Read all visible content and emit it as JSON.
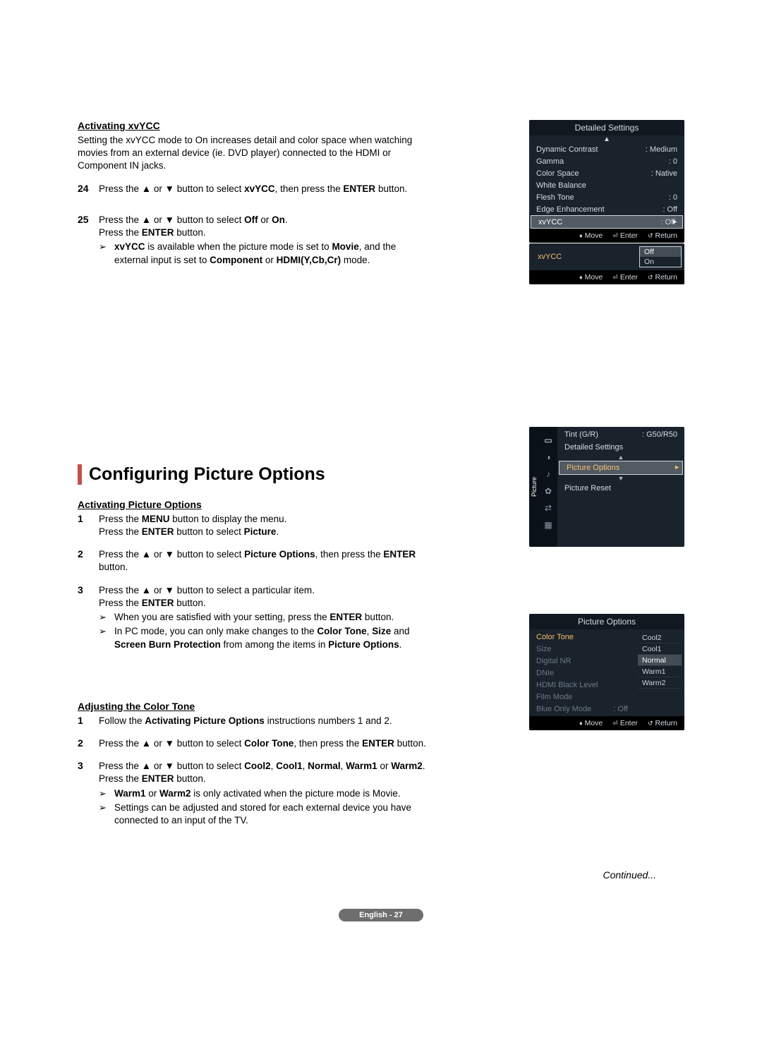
{
  "sect1": {
    "heading": "Activating xvYCC",
    "intro": "Setting the xvYCC mode to On increases detail and color space when watching movies from an external device (ie. DVD player) connected to the HDMI or Component IN jacks.",
    "step24_num": "24",
    "step24_a": "Press the ▲ or ▼ button to select ",
    "step24_b": "xvYCC",
    "step24_c": ", then press the ",
    "step24_d": "ENTER",
    "step24_e": " button.",
    "step25_num": "25",
    "step25_a": "Press the ▲ or ▼ button to select ",
    "step25_b": "Off",
    "step25_c": " or ",
    "step25_d": "On",
    "step25_e": ".",
    "step25_f": "Press the ",
    "step25_g": "ENTER",
    "step25_h": " button.",
    "note_a": "xvYCC",
    "note_b": " is available when the picture mode is set to ",
    "note_c": "Movie",
    "note_d": ", and the external input is set to ",
    "note_e": "Component",
    "note_f": " or ",
    "note_g": "HDMI(Y,Cb,Cr)",
    "note_h": " mode."
  },
  "osd1": {
    "title": "Detailed Settings",
    "rows": [
      {
        "label": "Dynamic Contrast",
        "val": ": Medium"
      },
      {
        "label": "Gamma",
        "val": ": 0"
      },
      {
        "label": "Color Space",
        "val": ": Native"
      },
      {
        "label": "White Balance",
        "val": ""
      },
      {
        "label": "Flesh Tone",
        "val": ": 0"
      },
      {
        "label": "Edge Enhancement",
        "val": ": Off"
      }
    ],
    "sel": {
      "label": "xvYCC",
      "val": ": Off"
    },
    "nav": {
      "move": "Move",
      "enter": "Enter",
      "ret": "Return"
    }
  },
  "osd2": {
    "label": "xvYCC",
    "opts": [
      "Off",
      "On"
    ],
    "nav": {
      "move": "Move",
      "enter": "Enter",
      "ret": "Return"
    }
  },
  "bigheading": "Configuring Picture Options",
  "sect2": {
    "heading": "Activating Picture Options",
    "s1_num": "1",
    "s1_a": "Press the ",
    "s1_b": "MENU",
    "s1_c": " button to display the menu.",
    "s1_d": "Press the ",
    "s1_e": "ENTER",
    "s1_f": " button to select ",
    "s1_g": "Picture",
    "s1_h": ".",
    "s2_num": "2",
    "s2_a": "Press the ▲ or ▼ button to select ",
    "s2_b": "Picture Options",
    "s2_c": ", then press the ",
    "s2_d": "ENTER",
    "s2_e": " button.",
    "s3_num": "3",
    "s3_a": "Press the ▲ or ▼ button to select a particular item.",
    "s3_b": "Press the ",
    "s3_c": "ENTER",
    "s3_d": " button.",
    "n1_a": "When you are satisfied with your setting, press the ",
    "n1_b": "ENTER",
    "n1_c": " button.",
    "n2_a": "In PC mode, you can only make changes to the ",
    "n2_b": "Color Tone",
    "n2_c": ", ",
    "n2_d": "Size",
    "n2_e": " and ",
    "n2_f": "Screen Burn Protection",
    "n2_g": " from among the items in ",
    "n2_h": "Picture Options",
    "n2_i": "."
  },
  "osd3": {
    "vlabel": "Picture",
    "rows": [
      {
        "label": "Tint (G/R)",
        "val": ": G50/R50"
      },
      {
        "label": "Detailed Settings",
        "val": ""
      }
    ],
    "hl": "Picture Options",
    "after": "Picture Reset"
  },
  "sect3": {
    "heading": "Adjusting the Color Tone",
    "s1_num": "1",
    "s1_a": "Follow the ",
    "s1_b": "Activating Picture Options",
    "s1_c": " instructions numbers 1 and 2.",
    "s2_num": "2",
    "s2_a": "Press the ▲ or ▼ button to select ",
    "s2_b": "Color Tone",
    "s2_c": ", then press the ",
    "s2_d": "ENTER",
    "s2_e": " button.",
    "s3_num": "3",
    "s3_a": "Press the ▲ or ▼ button to select ",
    "s3_b": "Cool2",
    "s3_c": ", ",
    "s3_d": "Cool1",
    "s3_e": ", ",
    "s3_f": "Normal",
    "s3_g": ", ",
    "s3_h": "Warm1",
    "s3_i": " or ",
    "s3_j": "Warm2",
    "s3_k": ".",
    "s3_l": "Press the ",
    "s3_m": "ENTER",
    "s3_n": " button.",
    "n1_a": "Warm1",
    "n1_b": " or ",
    "n1_c": "Warm2",
    "n1_d": " is only activated when the picture mode is Movie.",
    "n2": "Settings can be adjusted and stored for each external device you have connected to an input of the TV."
  },
  "osd4": {
    "title": "Picture Options",
    "left": [
      {
        "label": "Color Tone",
        "hl": true
      },
      {
        "label": "Size"
      },
      {
        "label": "Digital NR"
      },
      {
        "label": "DNIe"
      },
      {
        "label": "HDMI Black Level"
      },
      {
        "label": "Film Mode"
      },
      {
        "label": "Blue Only Mode",
        "val": ": Off"
      }
    ],
    "right": [
      "Cool2",
      "Cool1",
      "Normal",
      "Warm1",
      "Warm2"
    ],
    "right_sel": 2,
    "nav": {
      "move": "Move",
      "enter": "Enter",
      "ret": "Return"
    }
  },
  "continued": "Continued...",
  "pagenum": "English - 27"
}
